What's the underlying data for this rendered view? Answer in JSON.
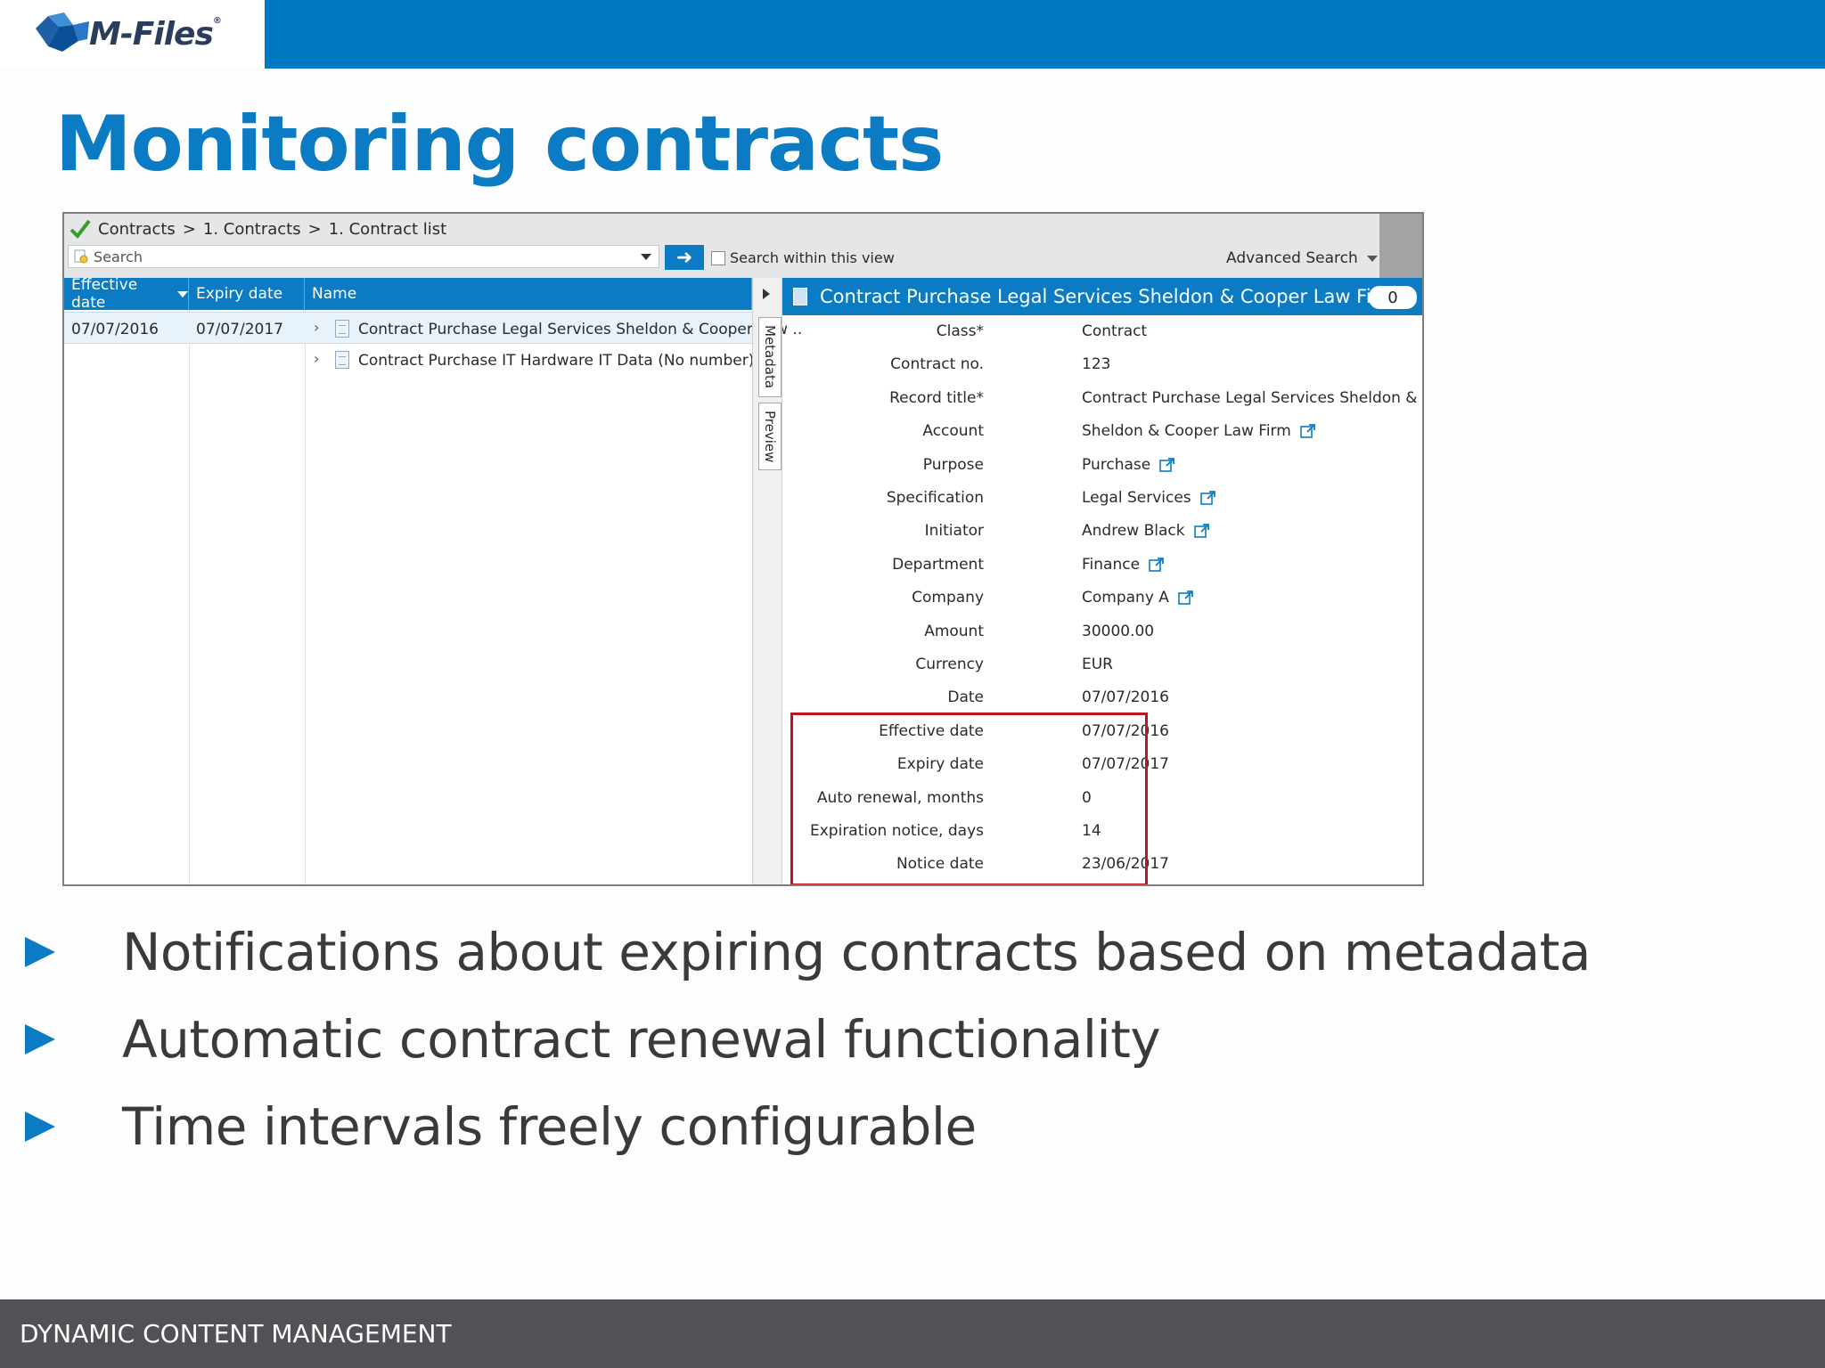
{
  "brand": {
    "logo_text": "M-Files",
    "logo_mark": "®",
    "accent": "#0b7cc4",
    "header_bar": "#0079c4"
  },
  "slide": {
    "title": "Monitoring contracts"
  },
  "app": {
    "breadcrumb": [
      "Contracts",
      ">",
      "1. Contracts",
      ">",
      "1. Contract list"
    ],
    "search": {
      "placeholder": "Search"
    },
    "search_within": "Search within this view",
    "advanced_search": "Advanced Search",
    "columns": [
      "Effective date",
      "Expiry date",
      "Name"
    ],
    "rows": [
      {
        "effective": "07/07/2016",
        "expiry": "07/07/2017",
        "name": "Contract Purchase Legal Services Sheldon & Cooper Law ..",
        "selected": true
      },
      {
        "effective": "",
        "expiry": "",
        "name": "Contract Purchase IT Hardware IT Data (No number)",
        "selected": false
      }
    ],
    "tabs": [
      "Metadata",
      "Preview"
    ],
    "metadata": {
      "title": "Contract Purchase Legal Services Sheldon & Cooper Law Fir...",
      "count": "0",
      "properties": [
        {
          "label": "Class*",
          "value": "Contract",
          "link": false
        },
        {
          "label": "Contract no.",
          "value": "123",
          "link": false
        },
        {
          "label": "Record title*",
          "value": "Contract Purchase Legal Services Sheldon & Cooper Law Firm",
          "link": false
        },
        {
          "label": "Account",
          "value": "Sheldon & Cooper Law Firm",
          "link": true
        },
        {
          "label": "Purpose",
          "value": "Purchase",
          "link": true
        },
        {
          "label": "Specification",
          "value": "Legal Services",
          "link": true
        },
        {
          "label": "Initiator",
          "value": "Andrew Black",
          "link": true
        },
        {
          "label": "Department",
          "value": "Finance",
          "link": true
        },
        {
          "label": "Company",
          "value": "Company A",
          "link": true
        },
        {
          "label": "Amount",
          "value": "30000.00",
          "link": false
        },
        {
          "label": "Currency",
          "value": "EUR",
          "link": false
        },
        {
          "label": "Date",
          "value": "07/07/2016",
          "link": false
        },
        {
          "label": "Effective date",
          "value": "07/07/2016",
          "link": false
        },
        {
          "label": "Expiry date",
          "value": "07/07/2017",
          "link": false
        },
        {
          "label": "Auto renewal, months",
          "value": "0",
          "link": false
        },
        {
          "label": "Expiration notice, days",
          "value": "14",
          "link": false
        },
        {
          "label": "Notice date",
          "value": "23/06/2017",
          "link": false
        }
      ]
    }
  },
  "bullets": [
    "Notifications about expiring contracts based on metadata",
    "Automatic contract renewal functionality",
    "Time intervals freely configurable"
  ],
  "footer": {
    "text": "DYNAMIC CONTENT MANAGEMENT"
  }
}
